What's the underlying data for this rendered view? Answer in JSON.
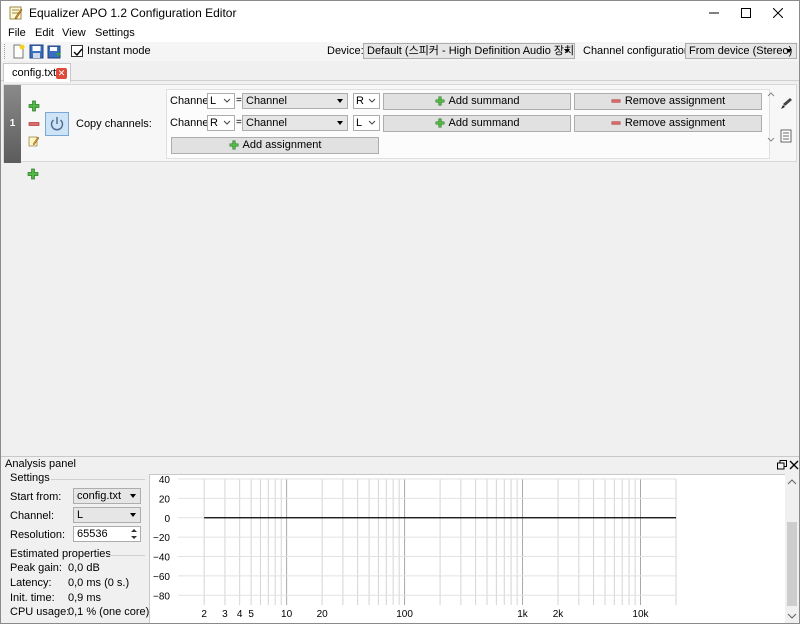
{
  "window": {
    "title": "Equalizer APO 1.2 Configuration Editor"
  },
  "menu": {
    "items": [
      "File",
      "Edit",
      "View",
      "Settings"
    ]
  },
  "toolbar": {
    "instant_mode_label": "Instant mode",
    "instant_mode_checked": true,
    "device_label": "Device:",
    "device_value": "Default (스피커 - High Definition Audio 장치)",
    "channel_config_label": "Channel configuration:",
    "channel_config_value": "From device (Stereo)"
  },
  "tabs": [
    {
      "label": "config.txt",
      "active": true
    }
  ],
  "filter": {
    "row_number": "1",
    "name": "Copy channels:",
    "assignments": [
      {
        "channel_label": "Channel",
        "target": "L",
        "eq": "=",
        "source_type": "Channel",
        "source": "R",
        "add_summand": "Add summand",
        "remove": "Remove assignment"
      },
      {
        "channel_label": "Channel",
        "target": "R",
        "eq": "=",
        "source_type": "Channel",
        "source": "L",
        "add_summand": "Add summand",
        "remove": "Remove assignment"
      }
    ],
    "add_assignment": "Add assignment"
  },
  "analysis": {
    "title": "Analysis panel",
    "settings_title": "Settings",
    "start_from_label": "Start from:",
    "start_from_value": "config.txt",
    "channel_label": "Channel:",
    "channel_value": "L",
    "resolution_label": "Resolution:",
    "resolution_value": "65536",
    "estimated_title": "Estimated properties",
    "peak_gain_label": "Peak gain:",
    "peak_gain_value": "0,0 dB",
    "latency_label": "Latency:",
    "latency_value": "0,0 ms (0 s.)",
    "init_time_label": "Init. time:",
    "init_time_value": "0,9 ms",
    "cpu_label": "CPU usage:",
    "cpu_value": "0,1 % (one core)"
  },
  "chart_data": {
    "type": "line",
    "y_ticks": [
      "40",
      "20",
      "0",
      "−20",
      "−40",
      "−60",
      "−80"
    ],
    "y_tick_values": [
      40,
      20,
      0,
      -20,
      -40,
      -60,
      -80
    ],
    "x_ticks": [
      "2",
      "3",
      "4",
      "5",
      "10",
      "20",
      "100",
      "1k",
      "2k",
      "10k"
    ],
    "x_tick_values": [
      2,
      3,
      4,
      5,
      10,
      20,
      100,
      1000,
      2000,
      10000
    ],
    "x_scale": "log",
    "ylim": [
      -90,
      40
    ],
    "series": [
      {
        "x": [
          2,
          20000
        ],
        "y": [
          0,
          0
        ]
      }
    ]
  }
}
